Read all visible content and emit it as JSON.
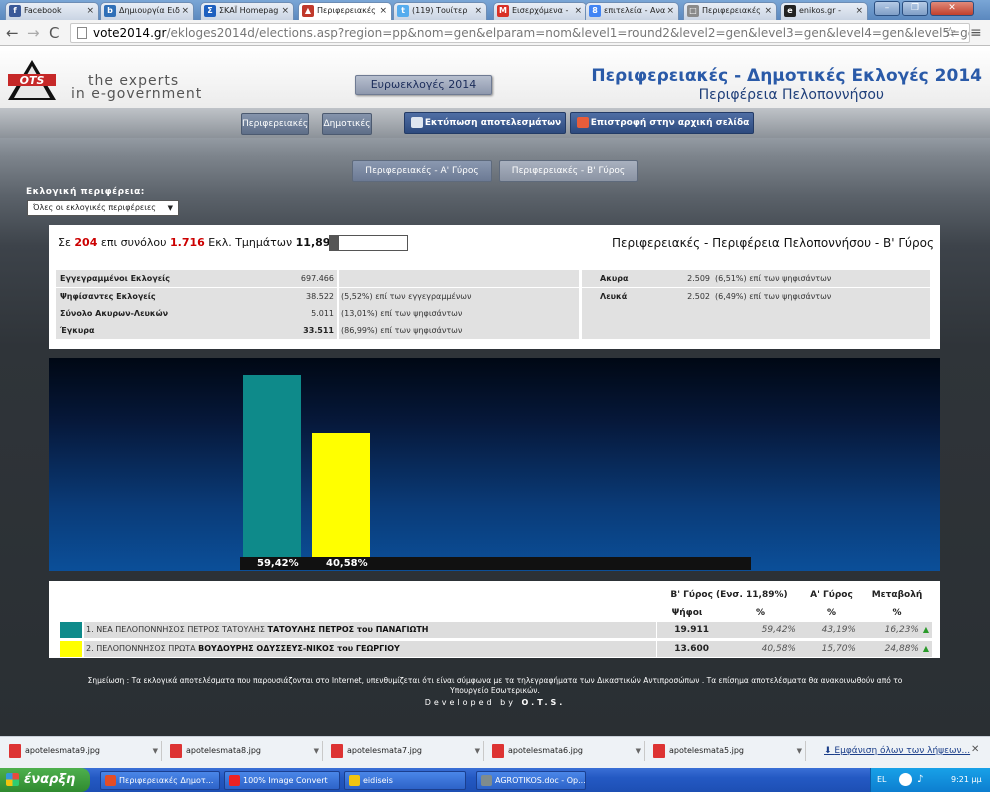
{
  "browser": {
    "tabs": [
      {
        "label": "Facebook",
        "icon": "facebook-icon",
        "color": "#3b5998",
        "glyph": "f"
      },
      {
        "label": "Δημιουργία Ειδ",
        "icon": "blog-icon",
        "color": "#2f6fb7",
        "glyph": "b"
      },
      {
        "label": "ΣΚΑΪ Homepag",
        "icon": "news-icon",
        "color": "#1d5fbf",
        "glyph": "Σ"
      },
      {
        "label": "Περιφερειακές",
        "icon": "ots-icon",
        "color": "#c0392b",
        "glyph": "▲"
      },
      {
        "label": "(119) Τουίτερ",
        "icon": "twitter-icon",
        "color": "#55acee",
        "glyph": "t"
      },
      {
        "label": "Εισερχόμενα -",
        "icon": "gmail-icon",
        "color": "#d93025",
        "glyph": "M"
      },
      {
        "label": "επιτελεία - Ανα",
        "icon": "google-icon",
        "color": "#4285f4",
        "glyph": "8"
      },
      {
        "label": "Περιφερειακές",
        "icon": "page-icon",
        "color": "#8a8a8a",
        "glyph": "□"
      },
      {
        "label": "enikos.gr -",
        "icon": "enikos-icon",
        "color": "#222222",
        "glyph": "e"
      }
    ],
    "url_host": "vote2014.gr",
    "url_path": "/ekloges2014d/elections.asp?region=pp&nom=gen&elparam=nom&level1=round2&level2=gen&level3=gen&level4=gen&level5=gen"
  },
  "header": {
    "logo_text": "OTS",
    "tagline_1": "the experts",
    "tagline_2": "in e-government",
    "euro_button": "Ευρωεκλογές 2014",
    "title": "Περιφερειακές - Δημοτικές Εκλογές 2014",
    "subtitle": "Περιφέρεια Πελοποννήσου"
  },
  "nav": {
    "perif": "Περιφερειακές",
    "dimot": "Δημοτικές",
    "print": "Εκτύπωση αποτελεσμάτων",
    "home": "Επιστροφή στην αρχική σελίδα",
    "round_a": "Περιφερειακές - Α' Γύρος",
    "round_b": "Περιφερειακές - Β' Γύρος"
  },
  "filter": {
    "label": "Εκλογική περιφέρεια:",
    "value": "Όλες οι εκλογικές περιφέρειες"
  },
  "summary": {
    "prefix": "Σε",
    "counted": "204",
    "mid": "επι συνόλου",
    "total": "1.716",
    "suffix": "Εκλ. Τμημάτων",
    "percent": "11,89%",
    "progress_fraction": 0.1189,
    "title": "Περιφερειακές - Περιφέρεια Πελοποννήσου - Β' Γύρος",
    "rows": [
      {
        "label": "Εγγεγραμμένοι Εκλογείς",
        "value": "697.466",
        "extra": ""
      },
      {
        "label": "Ψηφίσαντες Εκλογείς",
        "value": "38.522",
        "extra": "(5,52%) επί των εγγεγραμμένων"
      },
      {
        "label": "Σύνολο Ακυρων-Λευκών",
        "value": "5.011",
        "extra": "(13,01%) επί των ψηφισάντων"
      },
      {
        "label": "Έγκυρα",
        "value": "33.511",
        "extra": "(86,99%) επί των ψηφισάντων"
      }
    ],
    "right_rows": [
      {
        "label": "Ακυρα",
        "value": "2.509",
        "extra": "(6,51%) επί των ψηφισάντων"
      },
      {
        "label": "Λευκά",
        "value": "2.502",
        "extra": "(6,49%) επί των ψηφισάντων"
      }
    ]
  },
  "chart_data": {
    "type": "bar",
    "categories": [
      "ΝΕΑ ΠΕΛΟΠΟΝΝΗΣΟΣ",
      "ΠΕΛΟΠΟΝΝΗΣΟΣ ΠΡΩΤΑ"
    ],
    "values": [
      59.42,
      40.58
    ],
    "labels": [
      "59,42%",
      "40,58%"
    ],
    "colors": [
      "#0e8a8a",
      "#ffff00"
    ],
    "ylim": [
      0,
      75
    ]
  },
  "results": {
    "header_round_b": "Β' Γύρος (Ενσ. 11,89%)",
    "header_round_a": "Α' Γύρος",
    "header_change": "Μεταβολή",
    "sub_votes": "Ψήφοι",
    "sub_pct": "%",
    "sub_pct_a": "%",
    "sub_pct_change": "%",
    "rows": [
      {
        "num": "1.",
        "party": "ΝΕΑ ΠΕΛΟΠΟΝΝΗΣΟΣ ΠΕΤΡΟΣ ΤΑΤΟΥΛΗΣ",
        "candidate": "ΤΑΤΟΥΛΗΣ ΠΕΤΡΟΣ του ΠΑΝΑΓΙΩΤΗ",
        "votes": "19.911",
        "pct": "59,42%",
        "pct_a": "43,19%",
        "change": "16,23%",
        "arrow": "▲",
        "color": "#0e8a8a"
      },
      {
        "num": "2.",
        "party": "ΠΕΛΟΠΟΝΝΗΣΟΣ ΠΡΩΤΑ",
        "candidate": "ΒΟΥΔΟΥΡΗΣ ΟΔΥΣΣΕΥΣ-ΝΙΚΟΣ του ΓΕΩΡΓΙΟΥ",
        "votes": "13.600",
        "pct": "40,58%",
        "pct_a": "15,70%",
        "change": "24,88%",
        "arrow": "▲",
        "color": "#ffff00"
      }
    ]
  },
  "footer": {
    "note_1": "Σημείωση : Τα εκλογικά αποτελέσματα που παρουσιάζονται στο Internet, υπενθυμίζεται ότι είναι σύμφωνα με τα τηλεγραφήματα των Δικαστικών Αντιπροσώπων . Τα επίσημα αποτελέσματα θα ανακοινωθούν από το",
    "note_2": "Υπουργείο Εσωτερικών.",
    "developed": "Developed by",
    "developer": "O.T.S."
  },
  "downloads": {
    "files": [
      "apotelesmata9.jpg",
      "apotelesmata8.jpg",
      "apotelesmata7.jpg",
      "apotelesmata6.jpg",
      "apotelesmata5.jpg"
    ],
    "show_all": "Εμφάνιση όλων των λήψεων..."
  },
  "taskbar": {
    "start": "έναρξη",
    "items": [
      "Περιφερειακές Δημοτ...",
      "100% Image Convert",
      "eidiseis",
      "AGROTIKOS.doc - Op..."
    ],
    "lang": "EL",
    "time": "9:21 μμ"
  }
}
